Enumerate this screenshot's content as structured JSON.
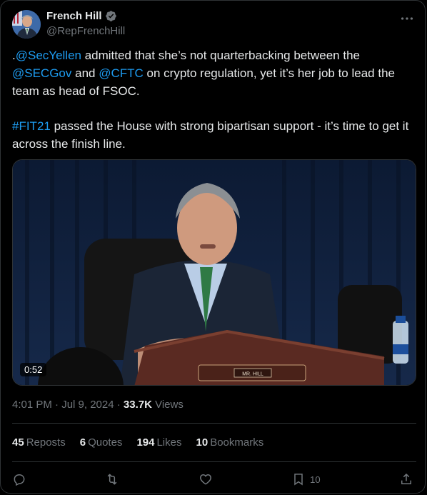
{
  "author": {
    "name": "French Hill",
    "handle": "@RepFrenchHill",
    "verified_color": "#71767b"
  },
  "post": {
    "p1_prefix": ".",
    "p1_mention1": "@SecYellen",
    "p1_text1": " admitted that she’s not quarterbacking between the ",
    "p1_mention2": "@SECGov",
    "p1_text2": " and ",
    "p1_mention3": "@CFTC",
    "p1_text3": " on crypto regulation, yet it’s her job to lead the team as head of FSOC.",
    "p2_hashtag": "#FIT21",
    "p2_text": " passed the House with strong bipartisan support - it’s time to get it across the finish line."
  },
  "media": {
    "duration": "0:52",
    "nameplate": "MR. HILL"
  },
  "meta": {
    "time_date": "4:01 PM · Jul 9, 2024 · ",
    "views_count": "33.7K",
    "views_label": " Views"
  },
  "stats": {
    "reposts_count": "45",
    "reposts_label": "Reposts",
    "quotes_count": "6",
    "quotes_label": "Quotes",
    "likes_count": "194",
    "likes_label": "Likes",
    "bookmarks_count": "10",
    "bookmarks_label": "Bookmarks"
  },
  "actions": {
    "bookmark_count": "10"
  },
  "colors": {
    "link": "#1d9bf0",
    "muted": "#71767b",
    "text": "#e7e9ea",
    "border": "#2f3336"
  },
  "icons": [
    "more-icon",
    "verified-icon",
    "reply-icon",
    "repost-icon",
    "like-icon",
    "bookmark-icon",
    "share-icon"
  ]
}
